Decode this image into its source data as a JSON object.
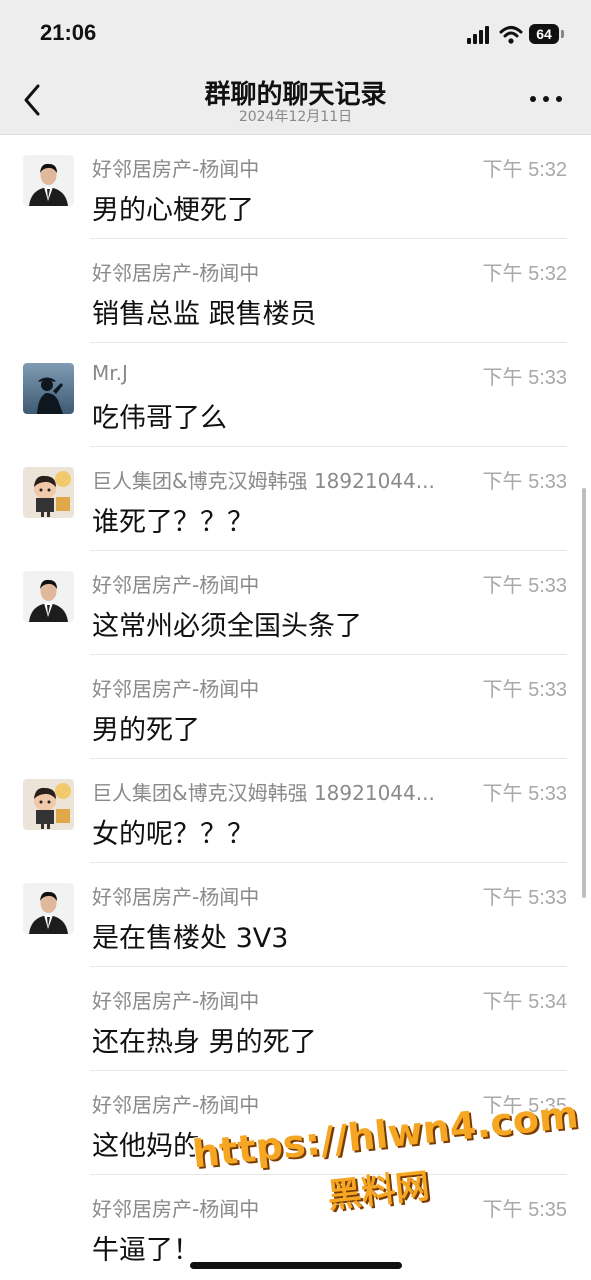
{
  "status_bar": {
    "time": "21:06",
    "battery": "64"
  },
  "header": {
    "title": "群聊的聊天记录",
    "subtitle": "2024年12月11日"
  },
  "messages": [
    {
      "sender": "好邻居房产-杨闻中",
      "time": "下午 5:32",
      "text": "男的心梗死了",
      "avatar": "suit"
    },
    {
      "sender": "好邻居房产-杨闻中",
      "time": "下午 5:32",
      "text": "销售总监 跟售楼员",
      "avatar": ""
    },
    {
      "sender": "Mr.J",
      "time": "下午 5:33",
      "text": "吃伟哥了么",
      "avatar": "silhouette"
    },
    {
      "sender": "巨人集团&博克汉姆韩强 18921044...",
      "time": "下午 5:33",
      "text": "谁死了？？？",
      "avatar": "cartoon"
    },
    {
      "sender": "好邻居房产-杨闻中",
      "time": "下午 5:33",
      "text": "这常州必须全国头条了",
      "avatar": "suit"
    },
    {
      "sender": "好邻居房产-杨闻中",
      "time": "下午 5:33",
      "text": "男的死了",
      "avatar": ""
    },
    {
      "sender": "巨人集团&博克汉姆韩强 18921044...",
      "time": "下午 5:33",
      "text": "女的呢？？？",
      "avatar": "cartoon"
    },
    {
      "sender": "好邻居房产-杨闻中",
      "time": "下午 5:33",
      "text": "是在售楼处 3V3",
      "avatar": "suit"
    },
    {
      "sender": "好邻居房产-杨闻中",
      "time": "下午 5:34",
      "text": "还在热身 男的死了",
      "avatar": ""
    },
    {
      "sender": "好邻居房产-杨闻中",
      "time": "下午 5:35",
      "text": "这他妈的",
      "avatar": ""
    },
    {
      "sender": "好邻居房产-杨闻中",
      "time": "下午 5:35",
      "text": "牛逼了！",
      "avatar": ""
    }
  ],
  "watermark": {
    "url": "https://hlwn4.com",
    "label": "黑料网"
  },
  "icons": {
    "back": "chevron-left-icon",
    "more": "more-horizontal-icon",
    "signal": "cellular-signal-icon",
    "wifi": "wifi-icon",
    "battery": "battery-icon"
  }
}
